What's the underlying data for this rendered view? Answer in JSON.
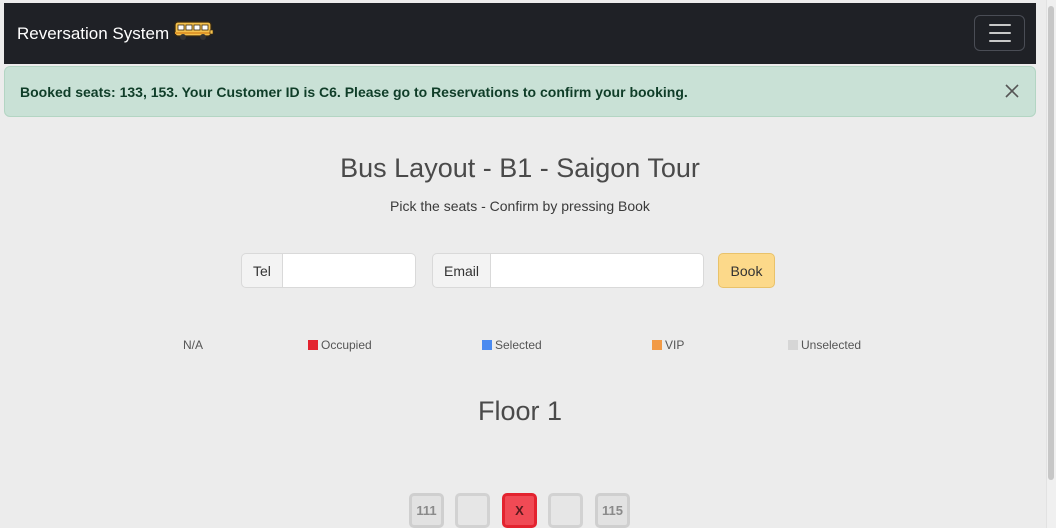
{
  "navbar": {
    "brand": "Reversation System",
    "bus_icon": "bus-icon",
    "menu_icon": "hamburger-menu-icon"
  },
  "alert": {
    "message": "Booked seats: 133, 153. Your Customer ID is C6. Please go to Reservations to confirm your booking.",
    "close_icon": "close-icon"
  },
  "page": {
    "title": "Bus Layout - B1 - Saigon Tour",
    "subtitle": "Pick the seats - Confirm by pressing Book"
  },
  "form": {
    "tel_label": "Tel",
    "tel_value": "",
    "email_label": "Email",
    "email_value": "",
    "book_label": "Book"
  },
  "legend": [
    {
      "label": "N/A",
      "color": ""
    },
    {
      "label": "Occupied",
      "color": "#e3232f"
    },
    {
      "label": "Selected",
      "color": "#4a8af0"
    },
    {
      "label": "VIP",
      "color": "#f29a45"
    },
    {
      "label": "Unselected",
      "color": "#d6d6d6"
    }
  ],
  "floor": {
    "title": "Floor 1",
    "seats": [
      {
        "label": "111",
        "state": "unselected"
      },
      {
        "label": "",
        "state": "empty"
      },
      {
        "label": "X",
        "state": "occupied"
      },
      {
        "label": "",
        "state": "empty"
      },
      {
        "label": "115",
        "state": "unselected"
      }
    ]
  },
  "colors": {
    "navbar_bg": "#1f2126",
    "alert_bg": "#c9e1d6",
    "book_button": "#fcd98a",
    "page_bg": "#ececec"
  }
}
